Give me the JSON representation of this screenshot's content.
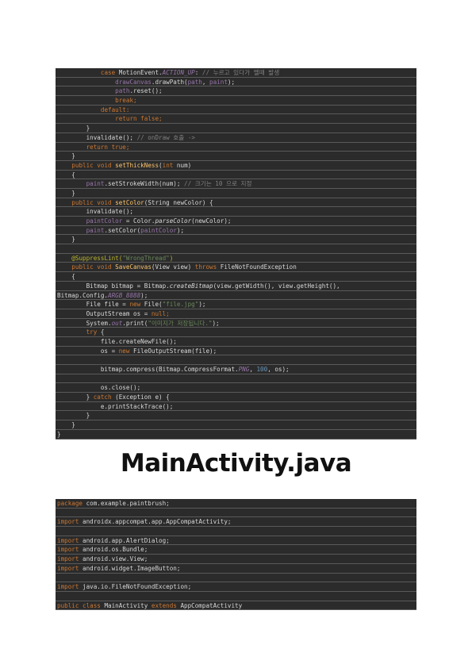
{
  "top_code": [
    [
      {
        "t": "            "
      },
      {
        "t": "case",
        "c": "kw"
      },
      {
        "t": " MotionEvent."
      },
      {
        "t": "ACTION_UP",
        "c": "it"
      },
      {
        "t": ": "
      },
      {
        "t": "// 누르고 있다가 뗄때 발생",
        "c": "cm"
      }
    ],
    [
      {
        "t": "                "
      },
      {
        "t": "drawCanvas",
        "c": "fld"
      },
      {
        "t": ".drawPath("
      },
      {
        "t": "path",
        "c": "fld"
      },
      {
        "t": ", "
      },
      {
        "t": "paint",
        "c": "fld"
      },
      {
        "t": ");"
      }
    ],
    [
      {
        "t": "                "
      },
      {
        "t": "path",
        "c": "fld"
      },
      {
        "t": ".reset();"
      }
    ],
    [
      {
        "t": "                "
      },
      {
        "t": "break;",
        "c": "kw"
      }
    ],
    [
      {
        "t": "            "
      },
      {
        "t": "default:",
        "c": "kw"
      }
    ],
    [
      {
        "t": "                "
      },
      {
        "t": "return false;",
        "c": "kw"
      }
    ],
    [
      {
        "t": "        }"
      }
    ],
    [
      {
        "t": "        invalidate(); "
      },
      {
        "t": "// onDraw 호출 ->",
        "c": "cm"
      }
    ],
    [
      {
        "t": "        "
      },
      {
        "t": "return true;",
        "c": "kw"
      }
    ],
    [
      {
        "t": "    }"
      }
    ],
    [
      {
        "t": "    "
      },
      {
        "t": "public void ",
        "c": "kw"
      },
      {
        "t": "setThickNess",
        "c": "fn"
      },
      {
        "t": "("
      },
      {
        "t": "int ",
        "c": "kw"
      },
      {
        "t": "num)"
      }
    ],
    [
      {
        "t": "    {"
      }
    ],
    [
      {
        "t": "        "
      },
      {
        "t": "paint",
        "c": "fld"
      },
      {
        "t": ".setStrokeWidth(num); "
      },
      {
        "t": "// 크기는 10 으로 지정",
        "c": "cm"
      }
    ],
    [
      {
        "t": "    }"
      }
    ],
    [
      {
        "t": "    "
      },
      {
        "t": "public void ",
        "c": "kw"
      },
      {
        "t": "setColor",
        "c": "fn"
      },
      {
        "t": "(String newColor) {"
      }
    ],
    [
      {
        "t": "        invalidate();"
      }
    ],
    [
      {
        "t": "        "
      },
      {
        "t": "paintColor",
        "c": "fld"
      },
      {
        "t": " = Color."
      },
      {
        "t": "parseColor",
        "c": "itw"
      },
      {
        "t": "(newColor);"
      }
    ],
    [
      {
        "t": "        "
      },
      {
        "t": "paint",
        "c": "fld"
      },
      {
        "t": ".setColor("
      },
      {
        "t": "paintColor",
        "c": "fld"
      },
      {
        "t": ");"
      }
    ],
    [
      {
        "t": "    }"
      }
    ],
    [
      {
        "t": ""
      }
    ],
    [
      {
        "t": "    "
      },
      {
        "t": "@SuppressLint(",
        "c": "ann"
      },
      {
        "t": "\"WrongThread\"",
        "c": "str"
      },
      {
        "t": ")",
        "c": "ann"
      }
    ],
    [
      {
        "t": "    "
      },
      {
        "t": "public void ",
        "c": "kw"
      },
      {
        "t": "SaveCanvas",
        "c": "fn"
      },
      {
        "t": "(View view) "
      },
      {
        "t": "throws ",
        "c": "kw"
      },
      {
        "t": "FileNotFoundException"
      }
    ],
    [
      {
        "t": "    {"
      }
    ],
    [
      {
        "t": "        Bitmap bitmap = Bitmap."
      },
      {
        "t": "createBitmap",
        "c": "itw"
      },
      {
        "t": "(view.getWidth(), view.getHeight(),"
      }
    ],
    [
      {
        "t": "Bitmap.Config."
      },
      {
        "t": "ARGB_8888",
        "c": "it"
      },
      {
        "t": ");"
      }
    ],
    [
      {
        "t": "        File file = "
      },
      {
        "t": "new ",
        "c": "kw"
      },
      {
        "t": "File("
      },
      {
        "t": "\"file.jpg\"",
        "c": "str"
      },
      {
        "t": ");"
      }
    ],
    [
      {
        "t": "        OutputStream os = "
      },
      {
        "t": "null;",
        "c": "kw"
      }
    ],
    [
      {
        "t": "        System."
      },
      {
        "t": "out",
        "c": "it"
      },
      {
        "t": ".print("
      },
      {
        "t": "\"이미지가 저장됩니다.\"",
        "c": "str"
      },
      {
        "t": ");"
      }
    ],
    [
      {
        "t": "        "
      },
      {
        "t": "try ",
        "c": "kw"
      },
      {
        "t": "{"
      }
    ],
    [
      {
        "t": "            file.createNewFile();"
      }
    ],
    [
      {
        "t": "            os = "
      },
      {
        "t": "new ",
        "c": "kw"
      },
      {
        "t": "FileOutputStream(file);"
      }
    ],
    [
      {
        "t": ""
      }
    ],
    [
      {
        "t": "            bitmap.compress(Bitmap.CompressFormat."
      },
      {
        "t": "PNG",
        "c": "it"
      },
      {
        "t": ", "
      },
      {
        "t": "100",
        "c": "num"
      },
      {
        "t": ", os);"
      }
    ],
    [
      {
        "t": ""
      }
    ],
    [
      {
        "t": "            os.close();"
      }
    ],
    [
      {
        "t": "        } "
      },
      {
        "t": "catch ",
        "c": "kw"
      },
      {
        "t": "(Exception e) {"
      }
    ],
    [
      {
        "t": "            e.printStackTrace();"
      }
    ],
    [
      {
        "t": "        }"
      }
    ],
    [
      {
        "t": "    }"
      }
    ],
    [
      {
        "t": "}"
      }
    ]
  ],
  "section_title": "MainActivity.java",
  "bottom_code": [
    [
      {
        "t": "package ",
        "c": "kw"
      },
      {
        "t": "com.example.paintbrush;"
      }
    ],
    [
      {
        "t": ""
      }
    ],
    [
      {
        "t": "import ",
        "c": "kw"
      },
      {
        "t": "androidx.appcompat.app.AppCompatActivity;"
      }
    ],
    [
      {
        "t": ""
      }
    ],
    [
      {
        "t": "import ",
        "c": "kw"
      },
      {
        "t": "android.app.AlertDialog;"
      }
    ],
    [
      {
        "t": "import ",
        "c": "kw"
      },
      {
        "t": "android.os.Bundle;"
      }
    ],
    [
      {
        "t": "import ",
        "c": "kw"
      },
      {
        "t": "android.view.View;"
      }
    ],
    [
      {
        "t": "import ",
        "c": "kw"
      },
      {
        "t": "android.widget.ImageButton;"
      }
    ],
    [
      {
        "t": ""
      }
    ],
    [
      {
        "t": "import ",
        "c": "kw"
      },
      {
        "t": "java.io.FileNotFoundException;"
      }
    ],
    [
      {
        "t": ""
      }
    ],
    [
      {
        "t": "public class ",
        "c": "kw"
      },
      {
        "t": "MainActivity "
      },
      {
        "t": "extends ",
        "c": "kw"
      },
      {
        "t": "AppCompatActivity"
      }
    ]
  ]
}
